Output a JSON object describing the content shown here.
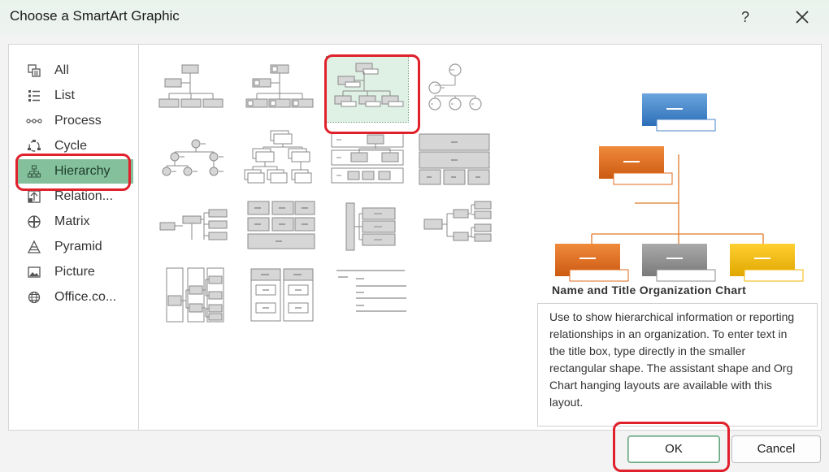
{
  "dialog": {
    "title": "Choose a SmartArt Graphic",
    "help_label": "?",
    "close_icon": "close-icon"
  },
  "categories": [
    {
      "label": "All",
      "icon": "all-icon"
    },
    {
      "label": "List",
      "icon": "list-icon"
    },
    {
      "label": "Process",
      "icon": "process-icon"
    },
    {
      "label": "Cycle",
      "icon": "cycle-icon"
    },
    {
      "label": "Hierarchy",
      "icon": "hierarchy-icon",
      "selected": true
    },
    {
      "label": "Relation...",
      "icon": "relationship-icon"
    },
    {
      "label": "Matrix",
      "icon": "matrix-icon"
    },
    {
      "label": "Pyramid",
      "icon": "pyramid-icon"
    },
    {
      "label": "Picture",
      "icon": "picture-icon"
    },
    {
      "label": "Office.co...",
      "icon": "globe-icon"
    }
  ],
  "layouts": {
    "selected_index": 2,
    "count": 15
  },
  "preview": {
    "title": "Name and Title Organization Chart",
    "description": "Use to show hierarchical information or reporting relationships in an organization. To enter text in the title box, type directly in the smaller rectangular shape. The assistant shape and Org Chart hanging layouts are available with this layout.",
    "colors": {
      "top": "#4a86c8",
      "left": "#e06b1e",
      "middle": "#8c8c8c",
      "right": "#f2b600",
      "connector": "#e07a2a"
    }
  },
  "buttons": {
    "ok_label": "OK",
    "cancel_label": "Cancel"
  }
}
